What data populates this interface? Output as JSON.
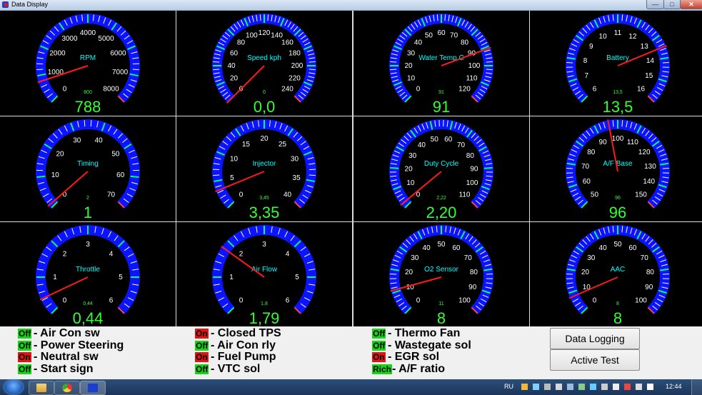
{
  "window": {
    "title": "Data Display",
    "minimize": "—",
    "maximize": "□",
    "close": "✕"
  },
  "colors": {
    "arc": "#0a14ff",
    "needle": "#ff1a1a",
    "tick": "#ffffff",
    "accent_tick": "#00ff66",
    "danger_tick": "#ff4444",
    "label": "#00ffff",
    "value": "#33ff33",
    "ok": "#17d417",
    "alarm": "#e01414"
  },
  "gauges": [
    {
      "label": "RPM",
      "ticks": [
        "0",
        "1000",
        "2000",
        "3000",
        "4000",
        "5000",
        "6000",
        "7000",
        "8000"
      ],
      "min": 0,
      "max": 8000,
      "value": 788,
      "value_text": "788",
      "small_text": "800"
    },
    {
      "label": "Speed kph",
      "ticks": [
        "0",
        "20",
        "40",
        "60",
        "80",
        "100",
        "120",
        "140",
        "160",
        "180",
        "200",
        "220",
        "240"
      ],
      "min": 0,
      "max": 240,
      "value": 0,
      "value_text": "0,0",
      "small_text": "0"
    },
    {
      "label": "Water Temp C",
      "ticks": [
        "0",
        "10",
        "20",
        "30",
        "40",
        "50",
        "60",
        "70",
        "80",
        "90",
        "100",
        "110",
        "120"
      ],
      "min": 0,
      "max": 120,
      "value": 91,
      "value_text": "91",
      "small_text": "91"
    },
    {
      "label": "Battery",
      "ticks": [
        "6",
        "7",
        "8",
        "9",
        "10",
        "11",
        "12",
        "13",
        "14",
        "15",
        "16"
      ],
      "min": 6,
      "max": 16,
      "value": 13.5,
      "value_text": "13,5",
      "small_text": "13,5"
    },
    {
      "label": "Timing",
      "ticks": [
        "0",
        "10",
        "20",
        "30",
        "40",
        "50",
        "60",
        "70"
      ],
      "min": 0,
      "max": 70,
      "value": 1,
      "value_text": "1",
      "small_text": "2"
    },
    {
      "label": "Injector",
      "ticks": [
        "0",
        "5",
        "10",
        "15",
        "20",
        "25",
        "30",
        "35",
        "40"
      ],
      "min": 0,
      "max": 40,
      "value": 3.35,
      "value_text": "3,35",
      "small_text": "3,45"
    },
    {
      "label": "Duty Cycle",
      "ticks": [
        "0",
        "10",
        "20",
        "30",
        "40",
        "50",
        "60",
        "70",
        "80",
        "90",
        "100",
        "110"
      ],
      "min": 0,
      "max": 110,
      "value": 2.2,
      "value_text": "2,20",
      "small_text": "2,22"
    },
    {
      "label": "A/F Base",
      "ticks": [
        "50",
        "60",
        "70",
        "80",
        "90",
        "100",
        "110",
        "120",
        "130",
        "140",
        "150"
      ],
      "min": 50,
      "max": 150,
      "value": 96,
      "value_text": "96",
      "small_text": "96"
    },
    {
      "label": "Throttle",
      "ticks": [
        "0",
        "1",
        "2",
        "3",
        "4",
        "5",
        "6"
      ],
      "min": 0,
      "max": 6,
      "value": 0.44,
      "value_text": "0,44",
      "small_text": "0,44"
    },
    {
      "label": "Air Flow",
      "ticks": [
        "0",
        "1",
        "2",
        "3",
        "4",
        "5",
        "6"
      ],
      "min": 0,
      "max": 6,
      "value": 1.79,
      "value_text": "1,79",
      "small_text": "1,8"
    },
    {
      "label": "O2 Sensor",
      "ticks": [
        "0",
        "10",
        "20",
        "30",
        "40",
        "50",
        "60",
        "70",
        "80",
        "90",
        "100"
      ],
      "min": 0,
      "max": 100,
      "value": 11,
      "value_text": "8",
      "small_text": "11"
    },
    {
      "label": "AAC",
      "ticks": [
        "0",
        "10",
        "20",
        "30",
        "40",
        "50",
        "60",
        "70",
        "80",
        "90",
        "100"
      ],
      "min": 0,
      "max": 100,
      "value": 8,
      "value_text": "8",
      "small_text": "8"
    }
  ],
  "status": [
    {
      "state": "Off",
      "label": "- Air Con sw"
    },
    {
      "state": "Off",
      "label": "- Power Steering"
    },
    {
      "state": "On",
      "label": "- Neutral sw"
    },
    {
      "state": "Off",
      "label": "- Start sign"
    },
    {
      "state": "On",
      "label": "- Closed TPS"
    },
    {
      "state": "Off",
      "label": "- Air Con rly"
    },
    {
      "state": "On",
      "label": "- Fuel Pump"
    },
    {
      "state": "Off",
      "label": "- VTC sol"
    },
    {
      "state": "Off",
      "label": "- Thermo Fan"
    },
    {
      "state": "Off",
      "label": "- Wastegate sol"
    },
    {
      "state": "On",
      "label": "- EGR sol"
    },
    {
      "state": "Rich",
      "label": "- A/F ratio"
    }
  ],
  "buttons": {
    "data_logging": "Data Logging",
    "active_test": "Active Test"
  },
  "taskbar": {
    "lang": "RU",
    "clock": "12:44",
    "apps": [
      "explorer-icon",
      "chrome-icon",
      "data-display-app-icon"
    ]
  }
}
